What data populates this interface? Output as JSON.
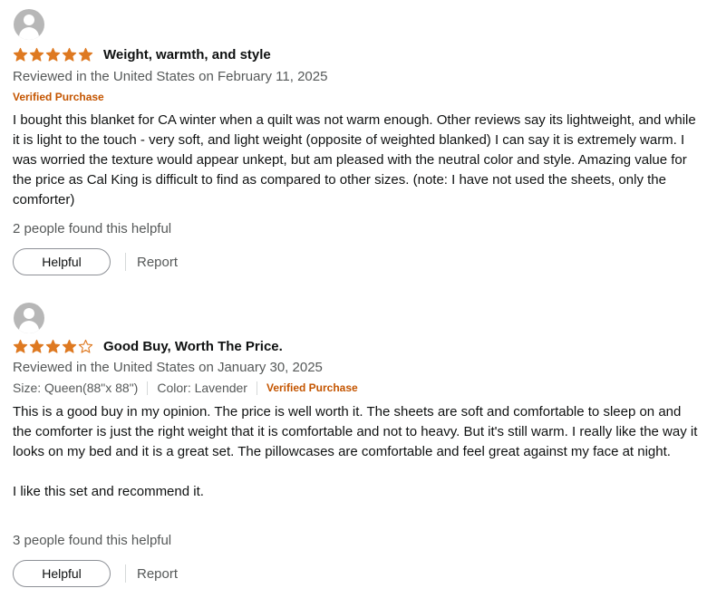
{
  "reviews": [
    {
      "reviewer_name": "",
      "rating": 5,
      "title": "Weight, warmth, and style",
      "date_line": "Reviewed in the United States on February 11, 2025",
      "verified": "Verified Purchase",
      "body": "I bought this blanket for CA winter when a quilt was not warm enough. Other reviews say its lightweight, and while it is light to the touch - very soft, and light weight (opposite of weighted blanked) I can say it is extremely warm. I was worried the texture would appear unkept, but am pleased with the neutral color and style. Amazing value for the price as Cal King is difficult to find as compared to other sizes. (note: I have not used the sheets, only the comforter)",
      "helpful_count": "2 people found this helpful",
      "helpful_label": "Helpful",
      "report_label": "Report"
    },
    {
      "reviewer_name": "",
      "rating": 4,
      "title": "Good Buy, Worth The Price.",
      "date_line": "Reviewed in the United States on January 30, 2025",
      "size": "Size: Queen(88\"x 88\")",
      "color": "Color: Lavender",
      "verified": "Verified Purchase",
      "body_p1": "This is a good buy in my opinion. The price is well worth it. The sheets are soft and comfortable to sleep on and the comforter is just the right weight that it is comfortable and not to heavy. But it's still warm. I really like the way it looks on my bed and it is a great set. The pillowcases are comfortable and feel great against my face at night.",
      "body_p2": "I like this set and recommend it.",
      "helpful_count": "3 people found this helpful",
      "helpful_label": "Helpful",
      "report_label": "Report"
    }
  ],
  "colors": {
    "star_fill": "#de7921",
    "verified": "#c45500",
    "meta_text": "#565959"
  }
}
